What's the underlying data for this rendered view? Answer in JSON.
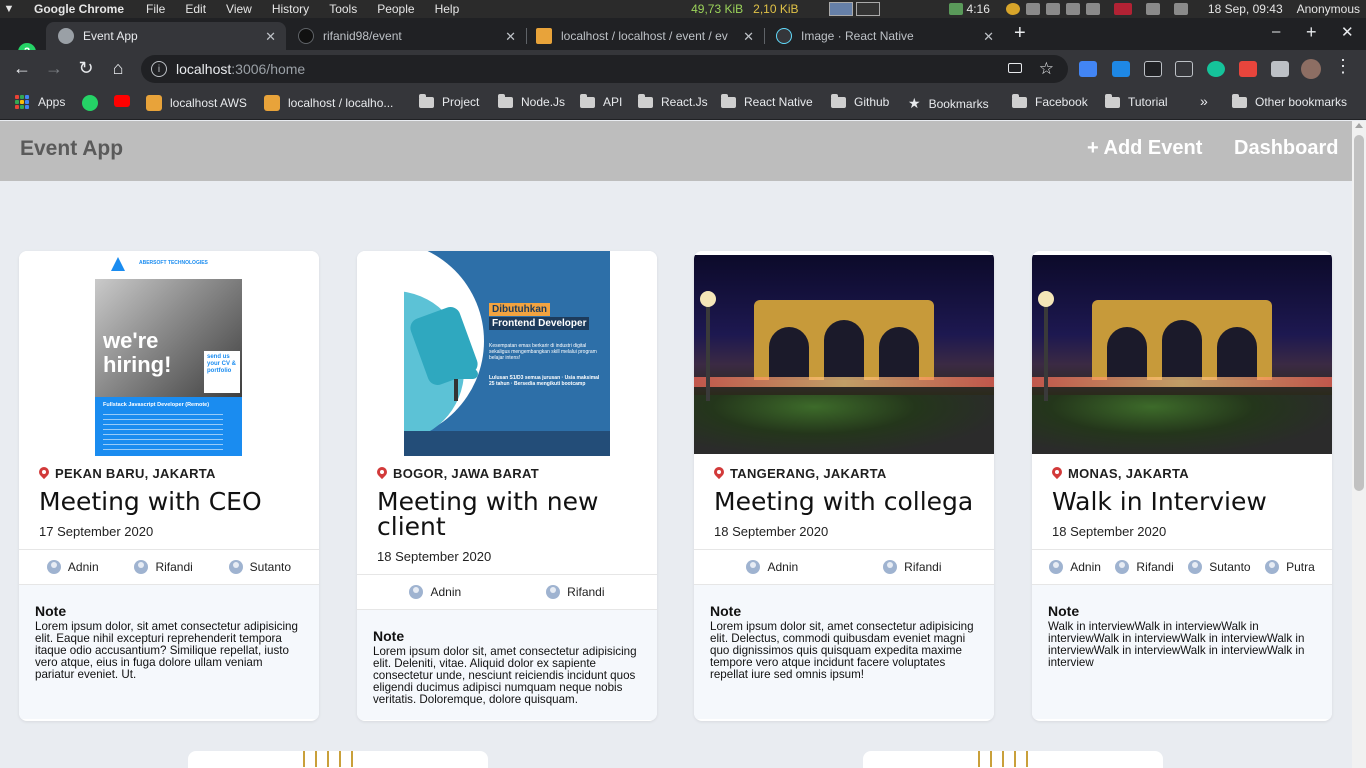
{
  "os": {
    "app_name": "Google Chrome",
    "menus": [
      "File",
      "Edit",
      "View",
      "History",
      "Tools",
      "People",
      "Help"
    ],
    "net_down": "49,73 KiB",
    "net_up": "2,10 KiB",
    "battery_time": "4:16",
    "datetime": "18 Sep, 09:43",
    "user": "Anonymous"
  },
  "browser": {
    "whatsapp_count": "2",
    "tabs": [
      {
        "title": "Event App",
        "active": true
      },
      {
        "title": "rifanid98/event",
        "active": false
      },
      {
        "title": "localhost / localhost / event / ev",
        "active": false
      },
      {
        "title": "Image · React Native",
        "active": false
      }
    ],
    "url_host": "localhost",
    "url_rest": ":3006/home",
    "bookmarks": [
      "Apps",
      "localhost AWS",
      "localhost / localho...",
      "Project",
      "Node.Js",
      "API",
      "React.Js",
      "React Native",
      "Github",
      "Bookmarks",
      "Facebook",
      "Tutorial",
      "Other bookmarks"
    ],
    "bookmarks_overflow": "»"
  },
  "app": {
    "title": "Event App",
    "add_event_label": "+ Add Event",
    "dashboard_label": "Dashboard"
  },
  "events": [
    {
      "location": "PEKAN BARU, JAKARTA",
      "title": "Meeting with CEO",
      "date": "17 September 2020",
      "participants": [
        "Adnin",
        "Rifandi",
        "Sutanto"
      ],
      "note_label": "Note",
      "note": "Lorem ipsum dolor, sit amet consectetur adipisicing elit. Eaque nihil excepturi reprehenderit tempora itaque odio accusantium? Similique repellat, iusto vero atque, eius in fuga dolore ullam veniam pariatur eveniet. Ut.",
      "image": "hiring",
      "poster": {
        "company": "ABERSOFT TECHNOLOGIES",
        "headline": "we're hiring!",
        "side": "send us your CV & portfolio",
        "role": "Fullstack Javascript Developer (Remote)"
      }
    },
    {
      "location": "BOGOR, JAWA BARAT",
      "title": "Meeting with new client",
      "date": "18 September 2020",
      "participants": [
        "Adnin",
        "Rifandi"
      ],
      "note_label": "Note",
      "note": "Lorem ipsum dolor sit, amet consectetur adipisicing elit. Deleniti, vitae. Aliquid dolor ex sapiente consectetur unde, nesciunt reiciendis incidunt quos eligendi ducimus adipisci numquam neque nobis veritatis. Doloremque, dolore quisquam.",
      "image": "frontend",
      "poster": {
        "headline1": "Dibutuhkan",
        "headline2": "Frontend Developer",
        "body": "Kesempatan emas berkarir di industri digital sekaligus mengembangkan skill melalui program belajar intens!",
        "req": "Lulusan S1/D3 semua jurusan · Usia maksimal 25 tahun · Bersedia mengikuti bootcamp"
      }
    },
    {
      "location": "TANGERANG, JAKARTA",
      "title": "Meeting with collega",
      "date": "18 September 2020",
      "participants": [
        "Adnin",
        "Rifandi"
      ],
      "note_label": "Note",
      "note": "Lorem ipsum dolor sit, amet consectetur adipisicing elit. Delectus, commodi quibusdam eveniet magni quo dignissimos quis quisquam expedita maxime tempore vero atque incidunt facere voluptates repellat iure sed omnis ipsum!",
      "image": "gate"
    },
    {
      "location": "MONAS, JAKARTA",
      "title": "Walk in Interview",
      "date": "18 September 2020",
      "participants": [
        "Adnin",
        "Rifandi",
        "Sutanto",
        "Putra"
      ],
      "note_label": "Note",
      "note": "Walk in interviewWalk in interviewWalk in interviewWalk in interviewWalk in interviewWalk in interviewWalk in interviewWalk in interviewWalk in interview",
      "image": "gate"
    }
  ]
}
